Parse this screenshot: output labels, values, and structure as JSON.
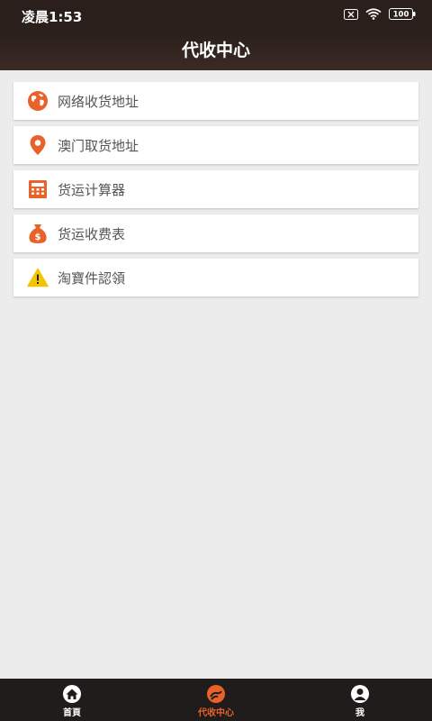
{
  "status": {
    "time": "凌晨1:53",
    "battery": "100"
  },
  "header": {
    "title": "代收中心"
  },
  "menu": {
    "items": [
      {
        "label": "网络收货地址",
        "icon": "globe-icon"
      },
      {
        "label": "澳门取货地址",
        "icon": "map-pin-icon"
      },
      {
        "label": "货运计算器",
        "icon": "calculator-icon"
      },
      {
        "label": "货运收费表",
        "icon": "money-bag-icon"
      },
      {
        "label": "淘寶件認領",
        "icon": "warning-icon"
      }
    ]
  },
  "tabbar": {
    "tabs": [
      {
        "label": "首頁",
        "icon": "home-icon",
        "active": false
      },
      {
        "label": "代收中心",
        "icon": "collection-icon",
        "active": true
      },
      {
        "label": "我",
        "icon": "user-icon",
        "active": false
      }
    ]
  },
  "colors": {
    "accent": "#e8622a",
    "header_bg": "#2a1f1b",
    "tabbar_bg": "#1f1c1b",
    "page_bg": "#ececec",
    "warning": "#f5c400"
  }
}
